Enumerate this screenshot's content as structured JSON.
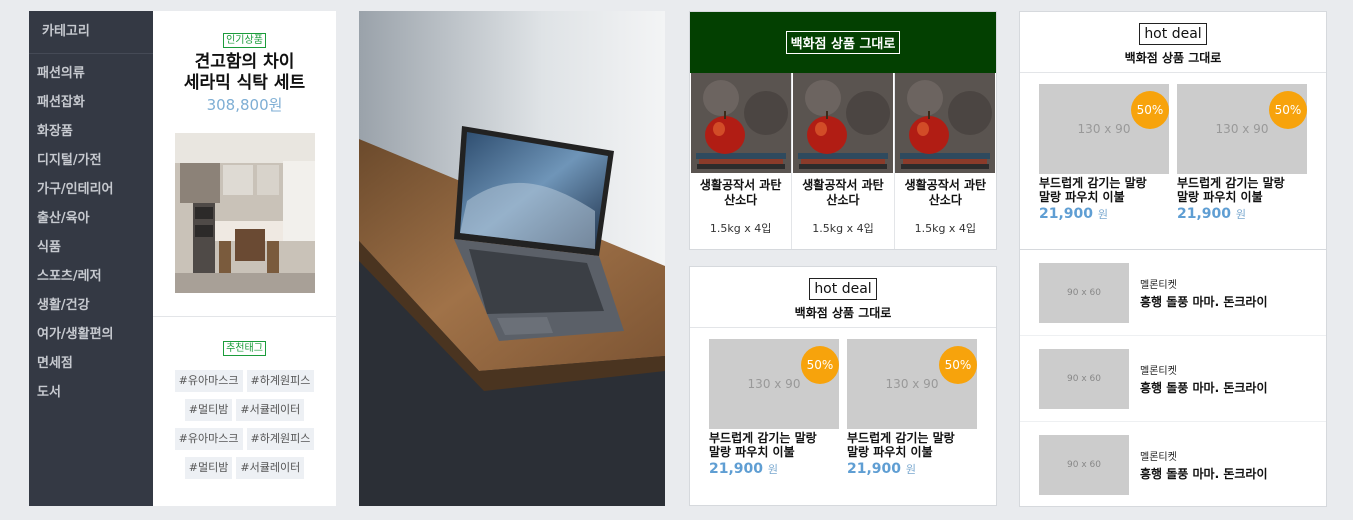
{
  "category": {
    "title": "카테고리",
    "items": [
      "패션의류",
      "패션잡화",
      "화장품",
      "디지털/가전",
      "가구/인테리어",
      "출산/육아",
      "식품",
      "스포츠/레저",
      "생활/건강",
      "여가/생활편의",
      "면세점",
      "도서"
    ]
  },
  "hot_product": {
    "badge": "인기상품",
    "name_line1": "견고함의 차이",
    "name_line2": "세라믹 식탁 세트",
    "price": "308,800원"
  },
  "recommended": {
    "badge": "추천태그",
    "tags": [
      "#유아마스크",
      "#하계원피스",
      "#멀티밤",
      "#서큘레이터",
      "#유아마스크",
      "#하계원피스",
      "#멀티밤",
      "#서큘레이터"
    ]
  },
  "dept_store": {
    "title": "백화점 상품 그대로",
    "items": [
      {
        "name_line1": "생활공작서 과탄",
        "name_line2": "산소다",
        "weight": "1.5kg x 4입"
      },
      {
        "name_line1": "생활공작서 과탄",
        "name_line2": "산소다",
        "weight": "1.5kg x 4입"
      },
      {
        "name_line1": "생활공작서 과탄",
        "name_line2": "산소다",
        "weight": "1.5kg x 4입"
      }
    ]
  },
  "hot_deal_a": {
    "badge": "hot deal",
    "subtitle": "백화점 상품 그대로",
    "deals": [
      {
        "placeholder": "130 x 90",
        "discount": "50%",
        "name_line1": "부드럽게 감기는 말랑",
        "name_line2": "말랑 파우치 이불",
        "price": "21,900",
        "unit": "원"
      },
      {
        "placeholder": "130 x 90",
        "discount": "50%",
        "name_line1": "부드럽게 감기는 말랑",
        "name_line2": "말랑 파우치 이불",
        "price": "21,900",
        "unit": "원"
      }
    ]
  },
  "hot_deal_b": {
    "badge": "hot deal",
    "subtitle": "백화점 상품 그대로",
    "deals": [
      {
        "placeholder": "130 x 90",
        "discount": "50%",
        "name_line1": "부드럽게 감기는 말랑",
        "name_line2": "말랑 파우치 이불",
        "price": "21,900",
        "unit": "원"
      },
      {
        "placeholder": "130 x 90",
        "discount": "50%",
        "name_line1": "부드럽게 감기는 말랑",
        "name_line2": "말랑 파우치 이불",
        "price": "21,900",
        "unit": "원"
      }
    ]
  },
  "tickets": [
    {
      "placeholder": "90 x 60",
      "category": "멜론티켓",
      "title": "흥행 돌풍 마마. 돈크라이"
    },
    {
      "placeholder": "90 x 60",
      "category": "멜론티켓",
      "title": "흥행 돌풍 마마. 돈크라이"
    },
    {
      "placeholder": "90 x 60",
      "category": "멜론티켓",
      "title": "흥행 돌풍 마마. 돈크라이"
    }
  ],
  "icons": {
    "kitchen": "kitchen-photo",
    "laptop": "laptop-photo",
    "apple": "apple-photo"
  },
  "colors": {
    "category_bg": "#343944",
    "green_header": "#034001",
    "discount": "#f7a30c",
    "price": "#5f9ed3",
    "badge_green": "#1b9c3b"
  }
}
